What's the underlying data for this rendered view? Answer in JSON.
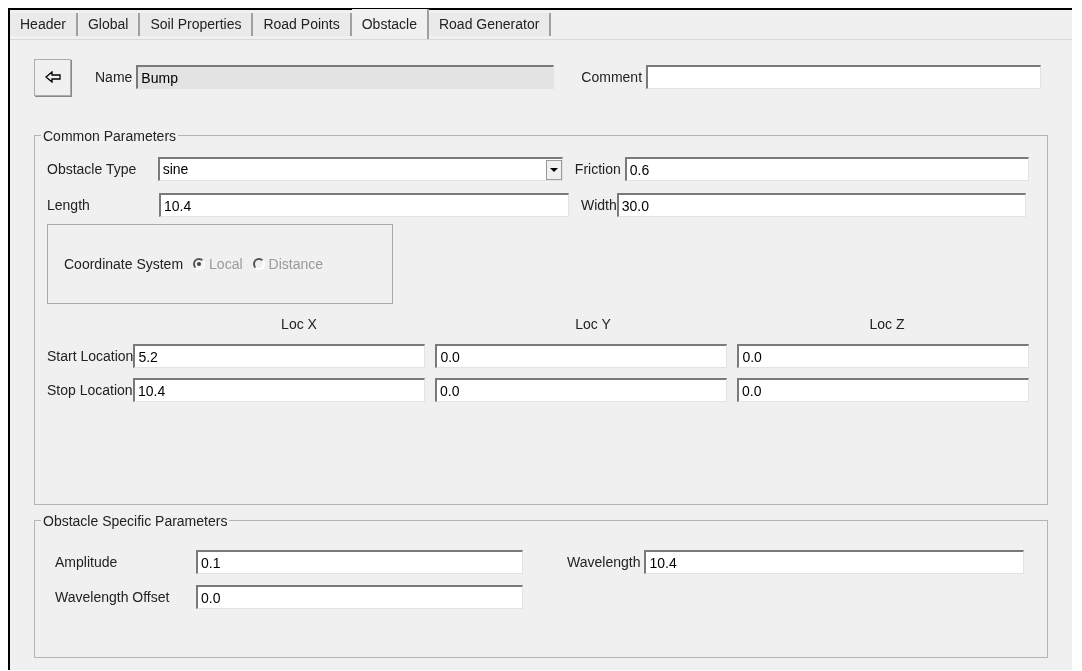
{
  "tabs": [
    {
      "label": "Header",
      "selected": false
    },
    {
      "label": "Global",
      "selected": false
    },
    {
      "label": "Soil Properties",
      "selected": false
    },
    {
      "label": "Road Points",
      "selected": false
    },
    {
      "label": "Obstacle",
      "selected": true
    },
    {
      "label": "Road Generator",
      "selected": false
    }
  ],
  "name": {
    "label": "Name",
    "value": "Bump",
    "disabled": true
  },
  "comment": {
    "label": "Comment"
  },
  "common_parameters": {
    "title": "Common Parameters",
    "obstacle_type": {
      "label": "Obstacle Type",
      "value": "sine"
    },
    "friction": {
      "label": "Friction",
      "value": "0.6"
    },
    "length": {
      "label": "Length",
      "value": "10.4"
    },
    "width": {
      "label": "Width",
      "value": "30.0"
    },
    "coordinate_system": {
      "label": "Coordinate System",
      "options": [
        {
          "label": "Local",
          "selected": true,
          "disabled": true
        },
        {
          "label": "Distance",
          "selected": false,
          "disabled": true
        }
      ]
    },
    "columns": [
      "Loc X",
      "Loc Y",
      "Loc Z"
    ],
    "rows": [
      {
        "label": "Start Location",
        "values": [
          "5.2",
          "0.0",
          "0.0"
        ]
      },
      {
        "label": "Stop Location",
        "values": [
          "10.4",
          "0.0",
          "0.0"
        ]
      }
    ]
  },
  "obstacle_specific_parameters": {
    "title": "Obstacle Specific Parameters",
    "amplitude": {
      "label": "Amplitude",
      "value": "0.1"
    },
    "wavelength": {
      "label": "Wavelength",
      "value": "10.4"
    },
    "wavelength_offset": {
      "label": "Wavelength Offset",
      "value": "0.0"
    }
  }
}
